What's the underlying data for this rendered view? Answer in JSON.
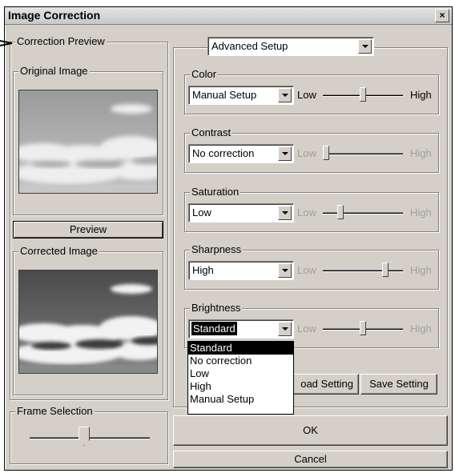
{
  "window": {
    "title": "Image Correction",
    "close_glyph": "×"
  },
  "left": {
    "correction_preview_label": "Correction Preview",
    "original_image_label": "Original Image",
    "preview_button": "Preview",
    "corrected_image_label": "Corrected Image",
    "frame_selection_label": "Frame Selection",
    "frame_selection_level": 0.45
  },
  "mode_select": {
    "value": "Advanced Setup"
  },
  "groups": {
    "color": {
      "label": "Color",
      "value": "Manual Setup",
      "low": "Low",
      "high": "High",
      "level": 0.5,
      "enabled": true
    },
    "contrast": {
      "label": "Contrast",
      "value": "No correction",
      "low": "Low",
      "high": "High",
      "level": 0.0,
      "enabled": false
    },
    "saturation": {
      "label": "Saturation",
      "value": "Low",
      "low": "Low",
      "high": "High",
      "level": 0.2,
      "enabled": false
    },
    "sharpness": {
      "label": "Sharpness",
      "value": "High",
      "low": "Low",
      "high": "High",
      "level": 0.8,
      "enabled": false
    },
    "brightness": {
      "label": "Brightness",
      "value": "Standard",
      "low": "Low",
      "high": "High",
      "level": 0.5,
      "enabled": false
    }
  },
  "brightness_options": [
    "Standard",
    "No correction",
    "Low",
    "High",
    "Manual Setup"
  ],
  "buttons": {
    "load_setting": "oad Setting",
    "save_setting": "Save Setting",
    "ok": "OK",
    "cancel": "Cancel"
  },
  "colors": {
    "face": "#d4d0c8",
    "selection": "#000000"
  }
}
